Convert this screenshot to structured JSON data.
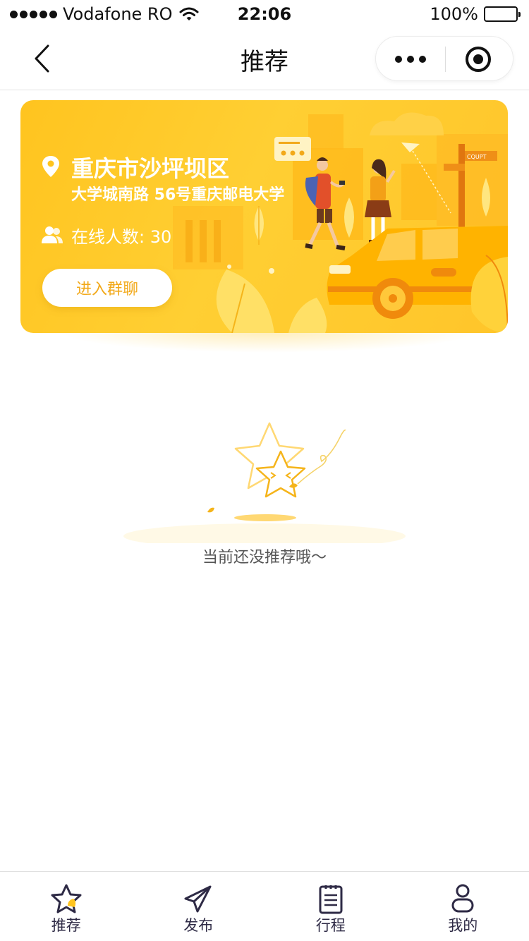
{
  "status_bar": {
    "carrier": "Vodafone RO",
    "time": "22:06",
    "battery": "100%"
  },
  "nav": {
    "title": "推荐",
    "back_icon": "chevron-left-icon",
    "more_icon": "more-dots-icon",
    "close_icon": "target-close-icon"
  },
  "banner": {
    "district": "重庆市沙坪坝区",
    "address": "大学城南路 56号重庆邮电大学",
    "online_label": "在线人数: 30",
    "join_button": "进入群聊",
    "sign_text": "CQUPT",
    "colors": {
      "background": "#ffc41f",
      "accent": "#f2a91a",
      "car": "#ffb300"
    }
  },
  "empty_state": {
    "message": "当前还没推荐哦～",
    "icon": "star-face-icon"
  },
  "tab_bar": {
    "items": [
      {
        "label": "推荐",
        "icon": "star-icon",
        "active": true
      },
      {
        "label": "发布",
        "icon": "paper-plane-icon",
        "active": false
      },
      {
        "label": "行程",
        "icon": "clipboard-icon",
        "active": false
      },
      {
        "label": "我的",
        "icon": "person-icon",
        "active": false
      }
    ]
  }
}
